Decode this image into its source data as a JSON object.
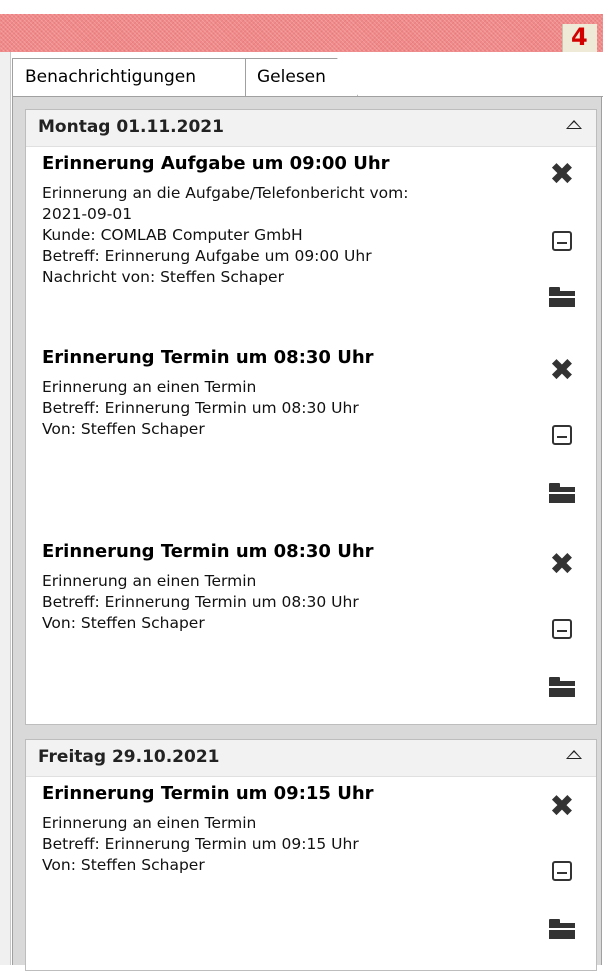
{
  "notification_count": "4",
  "tabs": [
    {
      "label": "Benachrichtigungen"
    },
    {
      "label": "Gelesen"
    }
  ],
  "groups": [
    {
      "date": "Montag 01.11.2021",
      "items": [
        {
          "title": "Erinnerung Aufgabe um 09:00 Uhr",
          "lines": [
            "Erinnerung an die Aufgabe/Telefonbericht vom:",
            "2021-09-01",
            "Kunde: COMLAB Computer GmbH",
            "Betreff: Erinnerung Aufgabe um 09:00 Uhr",
            "Nachricht von: Steffen Schaper"
          ]
        },
        {
          "title": "Erinnerung Termin um 08:30 Uhr",
          "lines": [
            "Erinnerung an einen Termin",
            "Betreff: Erinnerung Termin um 08:30 Uhr",
            "Von: Steffen Schaper"
          ]
        },
        {
          "title": "Erinnerung Termin um 08:30 Uhr",
          "lines": [
            "Erinnerung an einen Termin",
            "Betreff: Erinnerung Termin um 08:30 Uhr",
            "Von: Steffen Schaper"
          ]
        }
      ]
    },
    {
      "date": "Freitag 29.10.2021",
      "items": [
        {
          "title": "Erinnerung Termin um 09:15 Uhr",
          "lines": [
            "Erinnerung an einen Termin",
            "Betreff: Erinnerung Termin um 09:15 Uhr",
            "Von: Steffen Schaper"
          ]
        }
      ]
    }
  ],
  "icons": {
    "dismiss": "close-icon",
    "mark_read": "mark-read-icon",
    "open": "folder-icon",
    "collapse": "chevron-up-icon",
    "bell": "notification-bell-icon"
  },
  "colors": {
    "topbar": "#f08a8a",
    "badge": "#d30000",
    "group_header": "#f2f2f2",
    "panel_bg": "#d9d9d9"
  }
}
